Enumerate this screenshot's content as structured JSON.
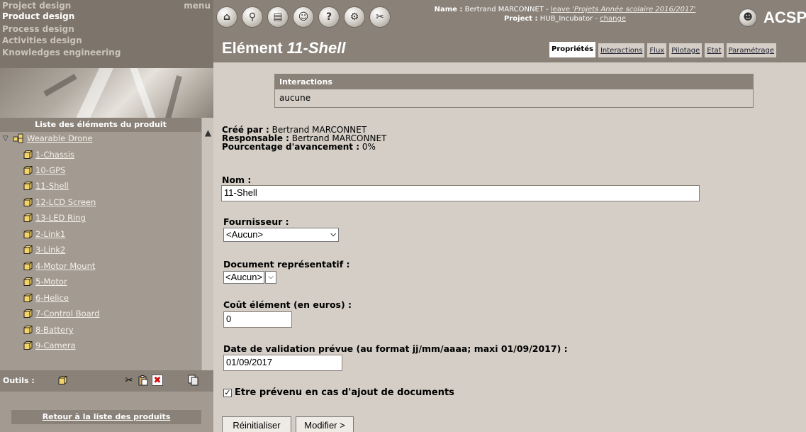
{
  "topmenu": {
    "items": [
      "Project design",
      "Product design",
      "Process design",
      "Activities design",
      "Knowledges engineering"
    ],
    "menu_label": "menu"
  },
  "sidebar": {
    "list_title": "Liste des éléments du produit",
    "root": "Wearable Drone",
    "items": [
      "1-Chassis",
      "10-GPS",
      "11-Shell",
      "12-LCD Screen",
      "13-LED Ring",
      "2-Link1",
      "3-Link2",
      "4-Motor Mount",
      "5-Motor",
      "6-Helice",
      "7-Control Board",
      "8-Battery",
      "9-Camera"
    ],
    "tools_label": "Outils :",
    "back_label": "Retour à la liste des produits"
  },
  "header": {
    "name_label": "Name :",
    "name_value": "Bertrand MARCONNET -",
    "leave_text": "leave",
    "leave_project": "'Projets Année scolaire 2016/2017'",
    "project_label": "Project :",
    "project_value": "HUB_Incubator -",
    "change_text": "change",
    "logo": "ACSP",
    "title_prefix": "Elément",
    "title_name": "11-Shell",
    "tabs": [
      "Propriétés",
      "Interactions",
      "Flux",
      "Pilotage",
      "Etat",
      "Paramétrage"
    ]
  },
  "main": {
    "interactions_title": "Interactions",
    "interactions_value": "aucune",
    "created_by_label": "Créé par :",
    "created_by": "Bertrand MARCONNET",
    "responsible_label": "Responsable :",
    "responsible": "Bertrand MARCONNET",
    "progress_label": "Pourcentage d'avancement :",
    "progress": "0%",
    "name_label": "Nom :",
    "name_value": "11-Shell",
    "supplier_label": "Fournisseur :",
    "supplier_value": "<Aucun>",
    "doc_label": "Document représentatif :",
    "doc_value": "<Aucun>",
    "cost_label": "Coût élément (en euros) :",
    "cost_value": "0",
    "date_label": "Date de validation prévue (au format jj/mm/aaaa; maxi 01/09/2017) :",
    "date_value": "01/09/2017",
    "notify_label": "Etre prévenu en cas d'ajout de documents",
    "reset_label": "Réinitialiser",
    "modify_label": "Modifier >"
  }
}
